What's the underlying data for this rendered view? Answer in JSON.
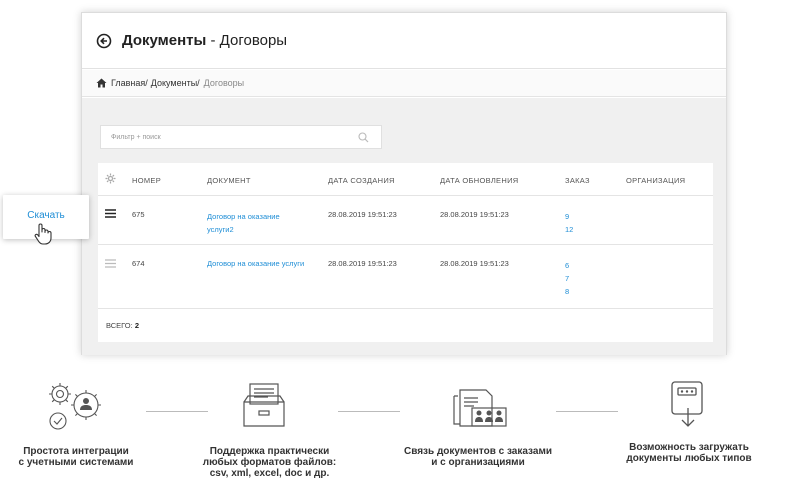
{
  "header": {
    "title_bold": "Документы",
    "title_rest": " - Договоры"
  },
  "breadcrumb": {
    "home": "Главная/",
    "documents": "Документы/",
    "current": "Договоры"
  },
  "filter": {
    "placeholder": "Фильтр + поиск"
  },
  "table": {
    "columns": [
      "НОМЕР",
      "ДОКУМЕНТ",
      "ДАТА СОЗДАНИЯ",
      "ДАТА ОБНОВЛЕНИЯ",
      "ЗАКАЗ",
      "ОРГАНИЗАЦИЯ"
    ],
    "rows": [
      {
        "number": "675",
        "doc_line1": "Договор на оказание",
        "doc_line2": "услуги2",
        "created": "28.08.2019 19:51:23",
        "updated": "28.08.2019 19:51:23",
        "orders": [
          "9",
          "12"
        ]
      },
      {
        "number": "674",
        "doc_line1": "Договор на оказание услуги",
        "created": "28.08.2019 19:51:23",
        "updated": "28.08.2019 19:51:23",
        "orders": [
          "6",
          "7",
          "8"
        ]
      }
    ],
    "total_label": "ВСЕГО:",
    "total_value": "2"
  },
  "popup": {
    "download": "Скачать"
  },
  "features": [
    {
      "icon": "integration-gears-icon",
      "line1": "Простота интеграции",
      "line2": "с учетными системами"
    },
    {
      "icon": "file-archive-icon",
      "line1": "Поддержка практически",
      "line2": "любых форматов файлов:",
      "line3": "csv, xml, excel, doc и др."
    },
    {
      "icon": "linked-documents-icon",
      "line1": "Связь документов с заказами",
      "line2": "и с организациями"
    },
    {
      "icon": "upload-download-icon",
      "line1": "Возможность загружать",
      "line2": "документы любых типов"
    }
  ],
  "colors": {
    "link": "#1f8ed6",
    "content_bg": "#f0f0f0"
  }
}
